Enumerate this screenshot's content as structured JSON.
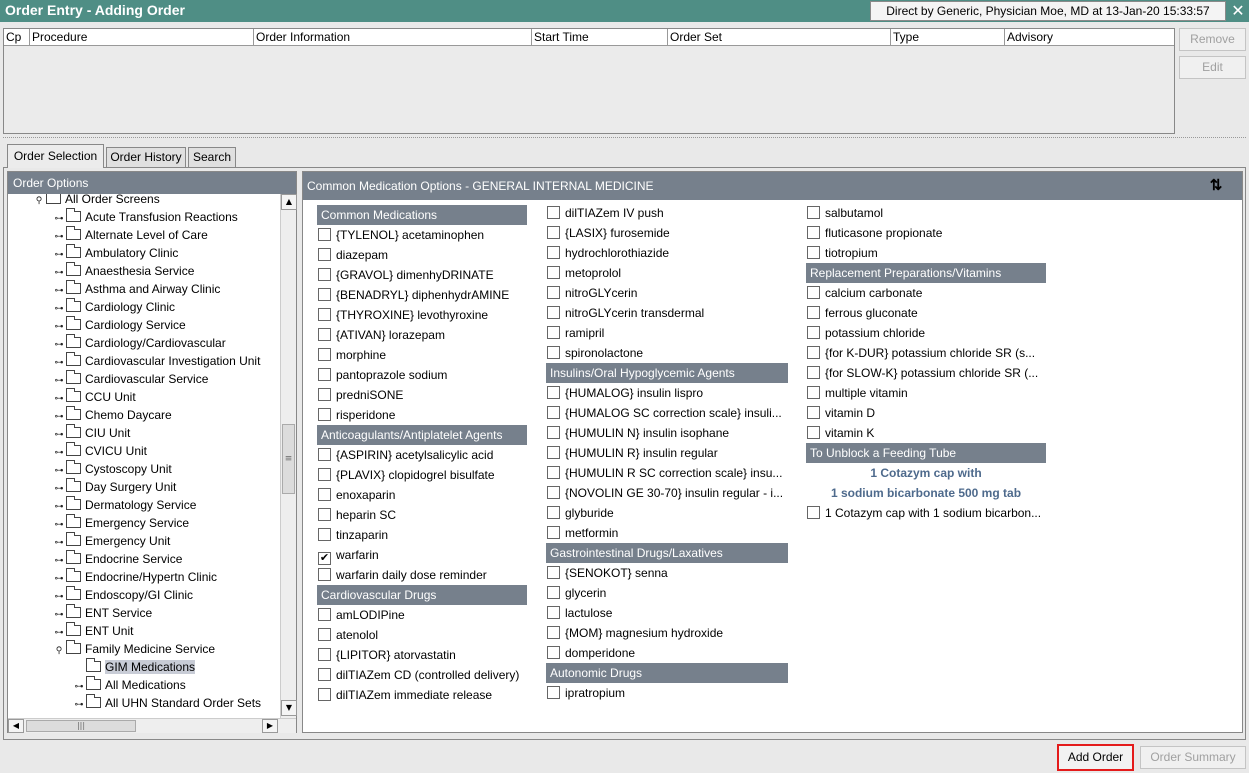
{
  "window": {
    "title": "Order Entry - Adding Order",
    "context": "Direct by Generic, Physician Moe, MD at 13-Jan-20 15:33:57",
    "close_icon": "close-icon"
  },
  "order_table": {
    "columns": [
      "Cp",
      "Procedure",
      "Order Information",
      "Start Time",
      "Order Set",
      "Type",
      "Advisory"
    ]
  },
  "side_buttons": {
    "remove": "Remove",
    "edit": "Edit"
  },
  "tabs": [
    "Order Selection",
    "Order History",
    "Search"
  ],
  "left_panel": {
    "title": "Order Options",
    "tree": [
      {
        "label": "All Order Screens",
        "state": "open"
      },
      {
        "label": "Acute Transfusion Reactions"
      },
      {
        "label": "Alternate Level of Care"
      },
      {
        "label": "Ambulatory Clinic"
      },
      {
        "label": "Anaesthesia Service"
      },
      {
        "label": "Asthma and Airway Clinic"
      },
      {
        "label": "Cardiology Clinic"
      },
      {
        "label": "Cardiology Service"
      },
      {
        "label": "Cardiology/Cardiovascular"
      },
      {
        "label": "Cardiovascular Investigation Unit"
      },
      {
        "label": "Cardiovascular Service"
      },
      {
        "label": "CCU Unit"
      },
      {
        "label": "Chemo Daycare"
      },
      {
        "label": "CIU Unit"
      },
      {
        "label": "CVICU Unit"
      },
      {
        "label": "Cystoscopy Unit"
      },
      {
        "label": "Day Surgery Unit"
      },
      {
        "label": "Dermatology Service"
      },
      {
        "label": "Emergency Service"
      },
      {
        "label": "Emergency Unit"
      },
      {
        "label": "Endocrine Service"
      },
      {
        "label": "Endocrine/Hypertn Clinic"
      },
      {
        "label": "Endoscopy/GI Clinic"
      },
      {
        "label": "ENT Service"
      },
      {
        "label": "ENT Unit"
      },
      {
        "label": "Family Medicine Service",
        "state": "open"
      },
      {
        "label": "GIM Medications",
        "selected": true
      },
      {
        "label": "All Medications"
      },
      {
        "label": "All UHN Standard Order Sets"
      }
    ]
  },
  "right_panel": {
    "title": "Common Medication Options - GENERAL INTERNAL MEDICINE",
    "col1": [
      {
        "section": "Common Medications"
      },
      {
        "label": "{TYLENOL} acetaminophen"
      },
      {
        "label": "diazepam"
      },
      {
        "label": "{GRAVOL} dimenhyDRINATE"
      },
      {
        "label": "{BENADRYL} diphenhydrAMINE"
      },
      {
        "label": "{THYROXINE} levothyroxine"
      },
      {
        "label": "{ATIVAN} lorazepam"
      },
      {
        "label": "morphine"
      },
      {
        "label": "pantoprazole sodium"
      },
      {
        "label": "predniSONE"
      },
      {
        "label": "risperidone"
      },
      {
        "section": "Anticoagulants/Antiplatelet Agents"
      },
      {
        "label": "{ASPIRIN} acetylsalicylic acid"
      },
      {
        "label": "{PLAVIX} clopidogrel bisulfate"
      },
      {
        "label": "enoxaparin"
      },
      {
        "label": "heparin SC"
      },
      {
        "label": "tinzaparin"
      },
      {
        "label": "warfarin",
        "checked": true
      },
      {
        "label": "warfarin daily dose reminder"
      },
      {
        "section": "Cardiovascular Drugs"
      },
      {
        "label": "amLODIPine"
      },
      {
        "label": "atenolol"
      },
      {
        "label": "{LIPITOR} atorvastatin"
      },
      {
        "label": "dilTIAZem CD (controlled delivery)"
      },
      {
        "label": "dilTIAZem immediate release"
      }
    ],
    "col2": [
      {
        "label": "dilTIAZem IV push"
      },
      {
        "label": "{LASIX} furosemide"
      },
      {
        "label": "hydrochlorothiazide"
      },
      {
        "label": "metoprolol"
      },
      {
        "label": "nitroGLYcerin"
      },
      {
        "label": "nitroGLYcerin transdermal"
      },
      {
        "label": "ramipril"
      },
      {
        "label": "spironolactone"
      },
      {
        "section": "Insulins/Oral Hypoglycemic Agents"
      },
      {
        "label": "{HUMALOG} insulin lispro"
      },
      {
        "label": "{HUMALOG SC correction scale} insuli..."
      },
      {
        "label": "{HUMULIN N} insulin isophane"
      },
      {
        "label": "{HUMULIN R} insulin regular"
      },
      {
        "label": "{HUMULIN R SC correction scale} insu..."
      },
      {
        "label": "{NOVOLIN GE 30-70} insulin regular - i..."
      },
      {
        "label": "glyburide"
      },
      {
        "label": "metformin"
      },
      {
        "section": "Gastrointestinal Drugs/Laxatives"
      },
      {
        "label": "{SENOKOT} senna"
      },
      {
        "label": "glycerin"
      },
      {
        "label": "lactulose"
      },
      {
        "label": "{MOM} magnesium hydroxide"
      },
      {
        "label": "domperidone"
      },
      {
        "section": "Autonomic Drugs"
      },
      {
        "label": "ipratropium"
      }
    ],
    "col3": [
      {
        "label": "salbutamol"
      },
      {
        "label": "fluticasone propionate"
      },
      {
        "label": "tiotropium"
      },
      {
        "section": "Replacement Preparations/Vitamins"
      },
      {
        "label": "calcium carbonate"
      },
      {
        "label": "ferrous gluconate"
      },
      {
        "label": "potassium chloride"
      },
      {
        "label": "{for K-DUR} potassium chloride SR (s..."
      },
      {
        "label": "{for SLOW-K} potassium chloride SR (..."
      },
      {
        "label": "multiple vitamin"
      },
      {
        "label": "vitamin D"
      },
      {
        "label": "vitamin K"
      },
      {
        "section": "To Unblock a Feeding Tube"
      },
      {
        "text": "1 Cotazym cap with"
      },
      {
        "text": "1 sodium bicarbonate 500 mg tab"
      },
      {
        "label": "1 Cotazym cap with 1 sodium bicarbon..."
      }
    ]
  },
  "bottom_buttons": {
    "add_order": "Add Order",
    "order_summary": "Order Summary"
  }
}
